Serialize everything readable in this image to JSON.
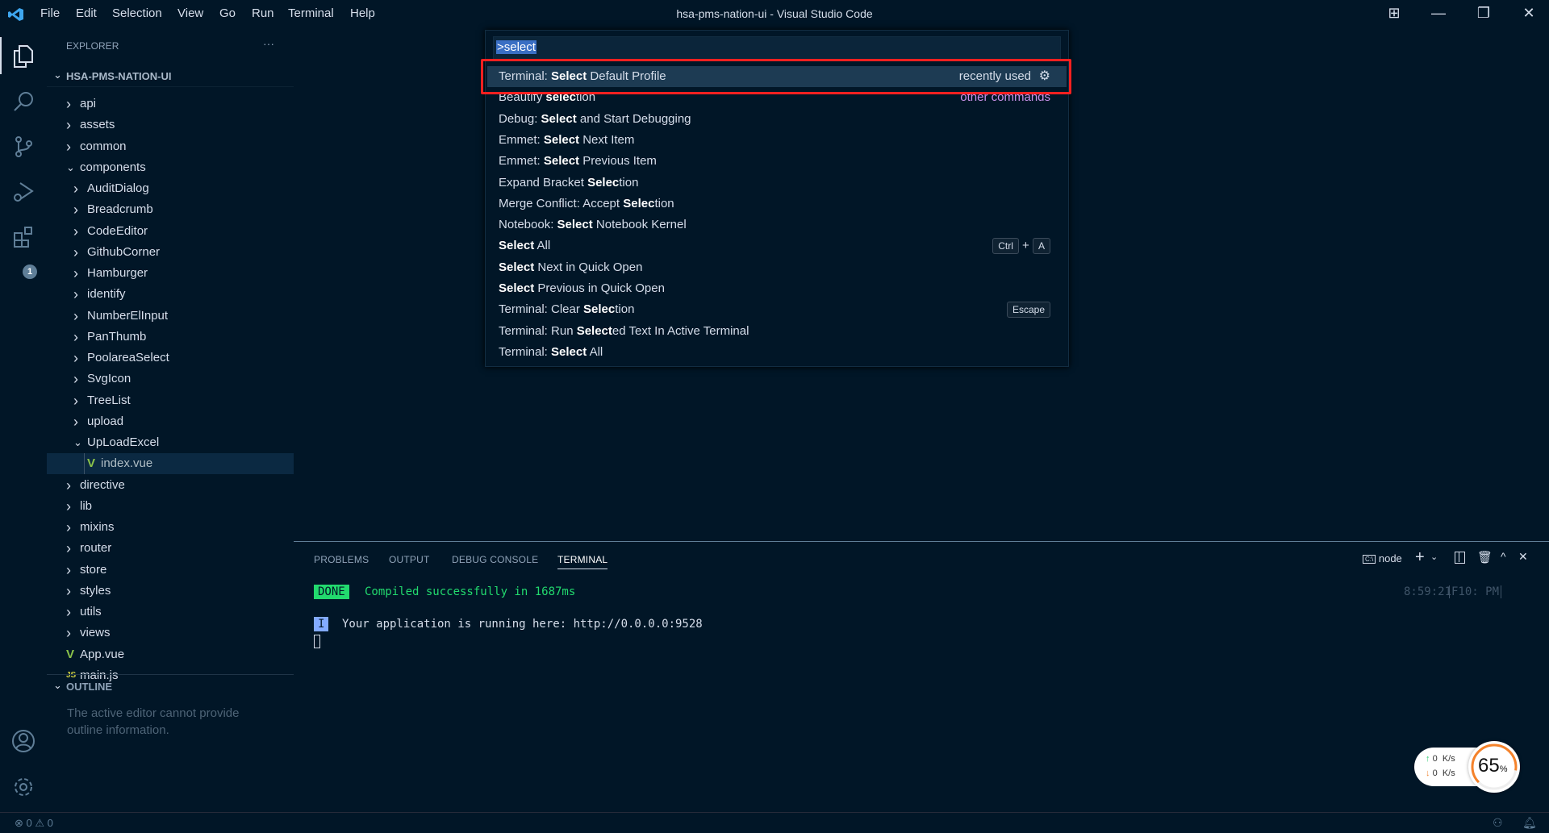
{
  "titlebar": {
    "title": "hsa-pms-nation-ui - Visual Studio Code",
    "menu": [
      "File",
      "Edit",
      "Selection",
      "View",
      "Go",
      "Run",
      "Terminal",
      "Help"
    ]
  },
  "activity_bar": {
    "icons": [
      "files-icon",
      "search-icon",
      "source-control-icon",
      "run-debug-icon",
      "extensions-icon",
      "account-icon",
      "settings-gear-icon"
    ],
    "extensions_badge": "1"
  },
  "sidebar": {
    "title": "EXPLORER",
    "more": "···",
    "root": "HSA-PMS-NATION-UI",
    "tree": [
      {
        "label": "api",
        "depth": 1,
        "type": "folder",
        "open": false
      },
      {
        "label": "assets",
        "depth": 1,
        "type": "folder",
        "open": false
      },
      {
        "label": "common",
        "depth": 1,
        "type": "folder",
        "open": false
      },
      {
        "label": "components",
        "depth": 1,
        "type": "folder",
        "open": true
      },
      {
        "label": "AuditDialog",
        "depth": 2,
        "type": "folder",
        "open": false
      },
      {
        "label": "Breadcrumb",
        "depth": 2,
        "type": "folder",
        "open": false
      },
      {
        "label": "CodeEditor",
        "depth": 2,
        "type": "folder",
        "open": false
      },
      {
        "label": "GithubCorner",
        "depth": 2,
        "type": "folder",
        "open": false
      },
      {
        "label": "Hamburger",
        "depth": 2,
        "type": "folder",
        "open": false
      },
      {
        "label": "identify",
        "depth": 2,
        "type": "folder",
        "open": false
      },
      {
        "label": "NumberElInput",
        "depth": 2,
        "type": "folder",
        "open": false
      },
      {
        "label": "PanThumb",
        "depth": 2,
        "type": "folder",
        "open": false
      },
      {
        "label": "PoolareaSelect",
        "depth": 2,
        "type": "folder",
        "open": false
      },
      {
        "label": "SvgIcon",
        "depth": 2,
        "type": "folder",
        "open": false
      },
      {
        "label": "TreeList",
        "depth": 2,
        "type": "folder",
        "open": false
      },
      {
        "label": "upload",
        "depth": 2,
        "type": "folder",
        "open": false
      },
      {
        "label": "UpLoadExcel",
        "depth": 2,
        "type": "folder",
        "open": true
      },
      {
        "label": "index.vue",
        "depth": 3,
        "type": "vue",
        "selected": true
      },
      {
        "label": "directive",
        "depth": 1,
        "type": "folder",
        "open": false
      },
      {
        "label": "lib",
        "depth": 1,
        "type": "folder",
        "open": false
      },
      {
        "label": "mixins",
        "depth": 1,
        "type": "folder",
        "open": false
      },
      {
        "label": "router",
        "depth": 1,
        "type": "folder",
        "open": false
      },
      {
        "label": "store",
        "depth": 1,
        "type": "folder",
        "open": false
      },
      {
        "label": "styles",
        "depth": 1,
        "type": "folder",
        "open": false
      },
      {
        "label": "utils",
        "depth": 1,
        "type": "folder",
        "open": false
      },
      {
        "label": "views",
        "depth": 1,
        "type": "folder",
        "open": false
      },
      {
        "label": "App.vue",
        "depth": 1,
        "type": "vue"
      },
      {
        "label": "main.js",
        "depth": 1,
        "type": "js"
      }
    ],
    "outline": {
      "title": "OUTLINE",
      "message": "The active editor cannot provide outline information."
    }
  },
  "palette": {
    "input": ">select",
    "items": [
      {
        "parts": [
          [
            "Terminal: ",
            0
          ],
          [
            "Select",
            1
          ],
          [
            " Default Profile",
            0
          ]
        ],
        "right": "recently used",
        "gear": true,
        "selected": true
      },
      {
        "parts": [
          [
            "Beautify ",
            0
          ],
          [
            "selec",
            1
          ],
          [
            "tion",
            0
          ]
        ],
        "right": "other commands"
      },
      {
        "parts": [
          [
            "Debug: ",
            0
          ],
          [
            "Select",
            1
          ],
          [
            " and Start Debugging",
            0
          ]
        ]
      },
      {
        "parts": [
          [
            "Emmet: ",
            0
          ],
          [
            "Select",
            1
          ],
          [
            " Next Item",
            0
          ]
        ]
      },
      {
        "parts": [
          [
            "Emmet: ",
            0
          ],
          [
            "Select",
            1
          ],
          [
            " Previous Item",
            0
          ]
        ]
      },
      {
        "parts": [
          [
            "Expand Bracket ",
            0
          ],
          [
            "Selec",
            1
          ],
          [
            "tion",
            0
          ]
        ]
      },
      {
        "parts": [
          [
            "Merge Conflict: Accept ",
            0
          ],
          [
            "Selec",
            1
          ],
          [
            "tion",
            0
          ]
        ]
      },
      {
        "parts": [
          [
            "Notebook: ",
            0
          ],
          [
            "Select",
            1
          ],
          [
            " Notebook Kernel",
            0
          ]
        ]
      },
      {
        "parts": [
          [
            "Select",
            1
          ],
          [
            " All",
            0
          ]
        ],
        "keys": [
          "Ctrl",
          "A"
        ]
      },
      {
        "parts": [
          [
            "Select",
            1
          ],
          [
            " Next in Quick Open",
            0
          ]
        ]
      },
      {
        "parts": [
          [
            "Select",
            1
          ],
          [
            " Previous in Quick Open",
            0
          ]
        ]
      },
      {
        "parts": [
          [
            "Terminal: Clear ",
            0
          ],
          [
            "Selec",
            1
          ],
          [
            "tion",
            0
          ]
        ],
        "keys": [
          "Escape"
        ]
      },
      {
        "parts": [
          [
            "Terminal: Run ",
            0
          ],
          [
            "Select",
            1
          ],
          [
            "ed Text In Active Terminal",
            0
          ]
        ]
      },
      {
        "parts": [
          [
            "Terminal: ",
            0
          ],
          [
            "Select",
            1
          ],
          [
            " All",
            0
          ]
        ]
      }
    ]
  },
  "panel": {
    "tabs": [
      "PROBLEMS",
      "OUTPUT",
      "DEBUG CONSOLE",
      "TERMINAL"
    ],
    "active_tab": "TERMINAL",
    "terminal_name": "node",
    "done_badge": "DONE",
    "done_text": "Compiled successfully in 1687ms",
    "time": "8:59:21",
    "time_suffix": "F10: PM",
    "info_badge": "I",
    "info_text": "Your application is running here: http://0.0.0.0:9528"
  },
  "net_widget": {
    "up": "0",
    "down": "0",
    "unit": "K/s",
    "percent": 65,
    "percent_sign": "%"
  },
  "status": {
    "errors": "0",
    "warnings": "0"
  },
  "colors": {
    "bg": "#011627",
    "accent": "#7e57c2",
    "done": "#22da6e",
    "highlight_border": "#ff2020",
    "vue": "#8bc34a",
    "js": "#cbcb41"
  }
}
